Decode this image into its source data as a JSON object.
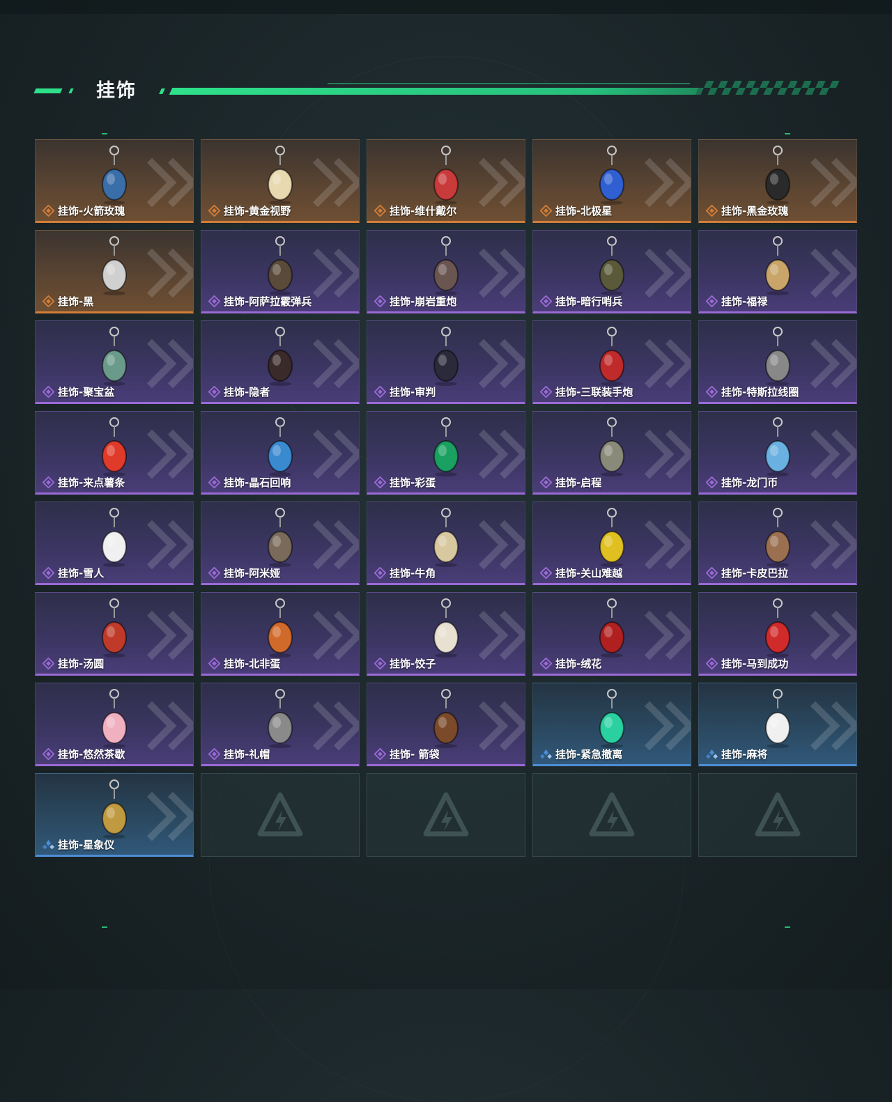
{
  "section": {
    "title": "挂饰"
  },
  "colors": {
    "accent": "#2fe08a",
    "rarity_orange": "#d47d37",
    "rarity_purple": "#9a6ad6",
    "rarity_blue": "#4e8ed6"
  },
  "items": [
    {
      "name": "挂饰-火箭玫瑰",
      "rarity": "orange",
      "icon": "rocket-rose-charm-icon",
      "charm_color": "#3a6ea8"
    },
    {
      "name": "挂饰-黄金视野",
      "rarity": "orange",
      "icon": "golden-vision-charm-icon",
      "charm_color": "#e8d9b0"
    },
    {
      "name": "挂饰-维什戴尔",
      "rarity": "orange",
      "icon": "wisadel-charm-icon",
      "charm_color": "#c93a3a"
    },
    {
      "name": "挂饰-北极星",
      "rarity": "orange",
      "icon": "polaris-charm-icon",
      "charm_color": "#2f5fd0"
    },
    {
      "name": "挂饰-黑金玫瑰",
      "rarity": "orange",
      "icon": "black-gold-rose-charm-icon",
      "charm_color": "#2a2a2a"
    },
    {
      "name": "挂饰-黑",
      "rarity": "orange",
      "icon": "hei-charm-icon",
      "charm_color": "#d0d0d0"
    },
    {
      "name": "挂饰-阿萨拉霰弹兵",
      "rarity": "purple",
      "icon": "ahsarah-shotgunner-charm-icon",
      "charm_color": "#5a4a3a"
    },
    {
      "name": "挂饰-崩岩重炮",
      "rarity": "purple",
      "icon": "rockfall-cannon-charm-icon",
      "charm_color": "#6a5550"
    },
    {
      "name": "挂饰-暗行哨兵",
      "rarity": "purple",
      "icon": "shadow-sentry-charm-icon",
      "charm_color": "#5a5a3a"
    },
    {
      "name": "挂饰-福禄",
      "rarity": "purple",
      "icon": "fortune-gourd-charm-icon",
      "charm_color": "#c9a56a"
    },
    {
      "name": "挂饰-聚宝盆",
      "rarity": "purple",
      "icon": "treasure-bowl-charm-icon",
      "charm_color": "#6a9a8a"
    },
    {
      "name": "挂饰-隐者",
      "rarity": "purple",
      "icon": "hermit-tarot-charm-icon",
      "charm_color": "#3a2a2a"
    },
    {
      "name": "挂饰-审判",
      "rarity": "purple",
      "icon": "judgement-tarot-charm-icon",
      "charm_color": "#2a2a3a"
    },
    {
      "name": "挂饰-三联装手炮",
      "rarity": "purple",
      "icon": "triple-hand-cannon-charm-icon",
      "charm_color": "#c02a2a"
    },
    {
      "name": "挂饰-特斯拉线圈",
      "rarity": "purple",
      "icon": "tesla-coil-charm-icon",
      "charm_color": "#888888"
    },
    {
      "name": "挂饰-来点薯条",
      "rarity": "purple",
      "icon": "french-fries-charm-icon",
      "charm_color": "#e03a2a"
    },
    {
      "name": "挂饰-晶石回响",
      "rarity": "purple",
      "icon": "crystal-echo-charm-icon",
      "charm_color": "#3a8ad0"
    },
    {
      "name": "挂饰-彩蛋",
      "rarity": "purple",
      "icon": "easter-egg-charm-icon",
      "charm_color": "#1aa060"
    },
    {
      "name": "挂饰-启程",
      "rarity": "purple",
      "icon": "departure-medal-charm-icon",
      "charm_color": "#8a8a7a"
    },
    {
      "name": "挂饰-龙门币",
      "rarity": "purple",
      "icon": "lungmen-coin-charm-icon",
      "charm_color": "#6ab0e0"
    },
    {
      "name": "挂饰-雪人",
      "rarity": "purple",
      "icon": "snowman-charm-icon",
      "charm_color": "#f0f0f0"
    },
    {
      "name": "挂饰-阿米娅",
      "rarity": "purple",
      "icon": "amiya-charm-icon",
      "charm_color": "#7a6a5a"
    },
    {
      "name": "挂饰-牛角",
      "rarity": "purple",
      "icon": "bull-horns-charm-icon",
      "charm_color": "#d8c8a0"
    },
    {
      "name": "挂饰-关山难越",
      "rarity": "purple",
      "icon": "mountain-pass-charm-icon",
      "charm_color": "#e0c020"
    },
    {
      "name": "挂饰-卡皮巴拉",
      "rarity": "purple",
      "icon": "capybara-charm-icon",
      "charm_color": "#9a7050"
    },
    {
      "name": "挂饰-汤圆",
      "rarity": "purple",
      "icon": "tangyuan-charm-icon",
      "charm_color": "#c03a2a"
    },
    {
      "name": "挂饰-北非蛋",
      "rarity": "purple",
      "icon": "shakshuka-charm-icon",
      "charm_color": "#d06a2a"
    },
    {
      "name": "挂饰-饺子",
      "rarity": "purple",
      "icon": "dumplings-charm-icon",
      "charm_color": "#e8e0d0"
    },
    {
      "name": "挂饰-绒花",
      "rarity": "purple",
      "icon": "velvet-flower-charm-icon",
      "charm_color": "#b02020"
    },
    {
      "name": "挂饰-马到成功",
      "rarity": "purple",
      "icon": "horse-success-charm-icon",
      "charm_color": "#d02a2a"
    },
    {
      "name": "挂饰-悠然茶歇",
      "rarity": "purple",
      "icon": "cupcake-charm-icon",
      "charm_color": "#f0b0c0"
    },
    {
      "name": "挂饰-礼帽",
      "rarity": "purple",
      "icon": "top-hat-charm-icon",
      "charm_color": "#8a8a8a"
    },
    {
      "name": "挂饰- 箭袋",
      "rarity": "purple",
      "icon": "quiver-charm-icon",
      "charm_color": "#7a4a2a"
    },
    {
      "name": "挂饰-紧急撤离",
      "rarity": "blue",
      "icon": "emergency-evac-charm-icon",
      "charm_color": "#2ad0a0"
    },
    {
      "name": "挂饰-麻将",
      "rarity": "blue",
      "icon": "mahjong-charm-icon",
      "charm_color": "#f0f0f0"
    },
    {
      "name": "挂饰-星象仪",
      "rarity": "blue",
      "icon": "astrolabe-charm-icon",
      "charm_color": "#c09a40"
    }
  ],
  "empty_slots": 4,
  "empty_slot_icon": "delta-logo-icon"
}
